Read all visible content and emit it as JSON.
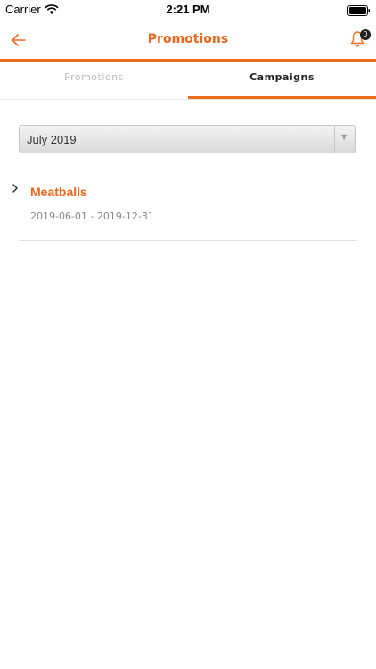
{
  "status_bar": {
    "carrier": "Carrier",
    "time": "2:21 PM"
  },
  "nav": {
    "title": "Promotions",
    "notification_count": "0",
    "accent_color": "#e8661d",
    "icons": {
      "back": "back-arrow-icon",
      "notifications": "bell-icon"
    }
  },
  "tabs": [
    {
      "label": "Promotions",
      "active": false
    },
    {
      "label": "Campaigns",
      "active": true
    }
  ],
  "month_select": {
    "value": "July 2019",
    "arrow": "▼"
  },
  "campaigns": [
    {
      "name": "Meatballs",
      "dates": "2019-06-01 - 2019-12-31",
      "chevron": "›"
    }
  ]
}
